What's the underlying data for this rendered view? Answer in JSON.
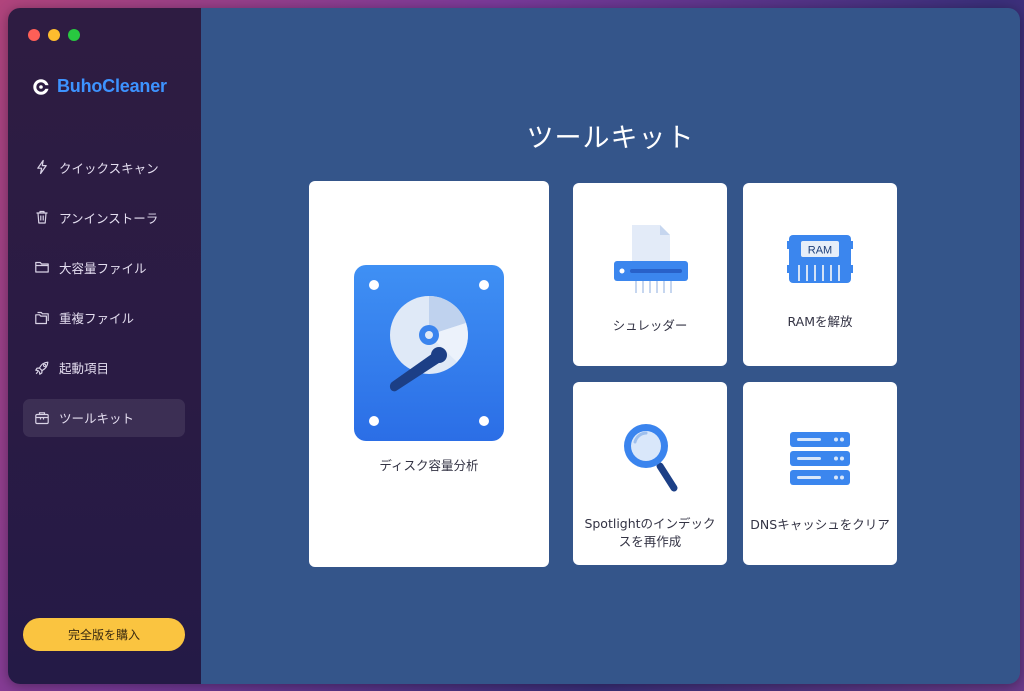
{
  "app": {
    "name": "BuhoCleaner"
  },
  "sidebar": {
    "items": [
      {
        "label": "クイックスキャン",
        "icon": "lightning-icon"
      },
      {
        "label": "アンインストーラ",
        "icon": "trash-icon"
      },
      {
        "label": "大容量ファイル",
        "icon": "folder-icon"
      },
      {
        "label": "重複ファイル",
        "icon": "duplicate-folder-icon"
      },
      {
        "label": "起動項目",
        "icon": "rocket-icon"
      },
      {
        "label": "ツールキット",
        "icon": "toolkit-icon",
        "active": true
      }
    ],
    "buy_label": "完全版を購入"
  },
  "main": {
    "title": "ツールキット",
    "tools": {
      "disk": {
        "label": "ディスク容量分析",
        "icon": "hard-disk-icon"
      },
      "shredder": {
        "label": "シュレッダー",
        "icon": "shredder-icon"
      },
      "ram": {
        "label": "RAMを解放",
        "icon": "ram-chip-icon",
        "chip_text": "RAM"
      },
      "spotlight": {
        "label": "Spotlightのインデックスを再作成",
        "icon": "magnifier-icon"
      },
      "dns": {
        "label": "DNSキャッシュをクリア",
        "icon": "server-icon"
      }
    }
  },
  "colors": {
    "main_bg": "#34558a",
    "sidebar_bg": "#2a1b44",
    "accent_blue": "#3d93ff",
    "buy_button": "#fac440"
  }
}
